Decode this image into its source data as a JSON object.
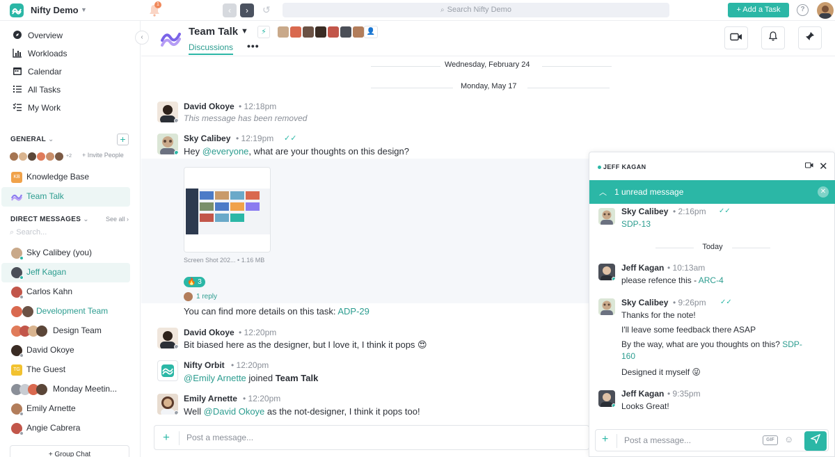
{
  "topbar": {
    "workspace": "Nifty Demo",
    "notification_count": "1",
    "search_placeholder": "Search Nifty Demo",
    "add_task_label": "+ Add a Task",
    "help_glyph": "?"
  },
  "sidebar": {
    "nav": [
      {
        "label": "Overview",
        "icon": "overview-icon"
      },
      {
        "label": "Workloads",
        "icon": "workloads-icon"
      },
      {
        "label": "Calendar",
        "icon": "calendar-icon"
      },
      {
        "label": "All Tasks",
        "icon": "tasks-icon"
      },
      {
        "label": "My Work",
        "icon": "mywork-icon"
      }
    ],
    "general_title": "GENERAL",
    "general_members_more": "+2",
    "invite_label": "+ Invite People",
    "channels": [
      {
        "label": "Knowledge Base",
        "badge": "KB",
        "color": "#f0a24a"
      },
      {
        "label": "Team Talk",
        "color": "#8b7cf0"
      }
    ],
    "dm_title": "DIRECT MESSAGES",
    "see_all": "See all",
    "dm_search_placeholder": "Search...",
    "dms": [
      {
        "label": "Sky Calibey (you)"
      },
      {
        "label": "Jeff Kagan"
      },
      {
        "label": "Carlos Kahn"
      },
      {
        "label": "Development Team"
      },
      {
        "label": "Design Team"
      },
      {
        "label": "David Okoye"
      },
      {
        "label": "The Guest",
        "badge": "TG"
      },
      {
        "label": "Monday Meetin..."
      },
      {
        "label": "Emily Arnette"
      },
      {
        "label": "Angie Cabrera"
      }
    ],
    "group_chat_label": "+ Group Chat"
  },
  "header": {
    "title": "Team Talk",
    "tab": "Discussions",
    "more": "•••"
  },
  "feed": {
    "date1": "Wednesday, February 24",
    "date2": "Monday, May 17",
    "messages": [
      {
        "author": "David Okoye",
        "time": "12:18pm",
        "text": "This message has been removed"
      },
      {
        "author": "Sky Calibey",
        "time": "12:19pm",
        "text_mention": "@everyone",
        "text_pre": "Hey ",
        "text_post": ", what are your thoughts on this design?"
      },
      {
        "author": "David Okoye",
        "time": "12:20pm",
        "text": "Bit biased here as the designer, but I love it, I think it pops 😍"
      },
      {
        "author": "Nifty Orbit",
        "time": "12:20pm",
        "text_mention": "@Emily Arnette",
        "text_post": " joined ",
        "text_bold": "Team Talk"
      },
      {
        "author": "Emily Arnette",
        "time": "12:20pm",
        "text_pre": "Well ",
        "text_mention": "@David Okoye",
        "text_post": " as the not-designer, I think it pops too!"
      }
    ],
    "attachment_caption": "Screen Shot 202... • 1.16 MB",
    "reaction": "🔥 3",
    "reply_label": "1 reply",
    "task_text": "You can find more details on this task: ",
    "task_link": "ADP-29",
    "composer_placeholder": "Post a message..."
  },
  "popup": {
    "title": "JEFF KAGAN",
    "unread": "1 unread message",
    "today": "Today",
    "messages": [
      {
        "author": "Sky Calibey",
        "time": "2:16pm",
        "lines": [
          "SDP-13"
        ]
      },
      {
        "author": "Jeff Kagan",
        "time": "10:13am",
        "line_pre": "please refence this - ",
        "line_link": "ARC-4"
      },
      {
        "author": "Sky Calibey",
        "time": "9:26pm",
        "l1": "Thanks for the note!",
        "l2": "I'll leave some feedback there ASAP",
        "l3_pre": "By the way, what are you thoughts on this? ",
        "l3_link": "SDP-",
        "l3_link2": "160",
        "l4": "Designed it myself 😜"
      },
      {
        "author": "Jeff Kagan",
        "time": "9:35pm",
        "text": "Looks Great!"
      }
    ],
    "composer_placeholder": "Post a message...",
    "gif_label": "GIF"
  }
}
